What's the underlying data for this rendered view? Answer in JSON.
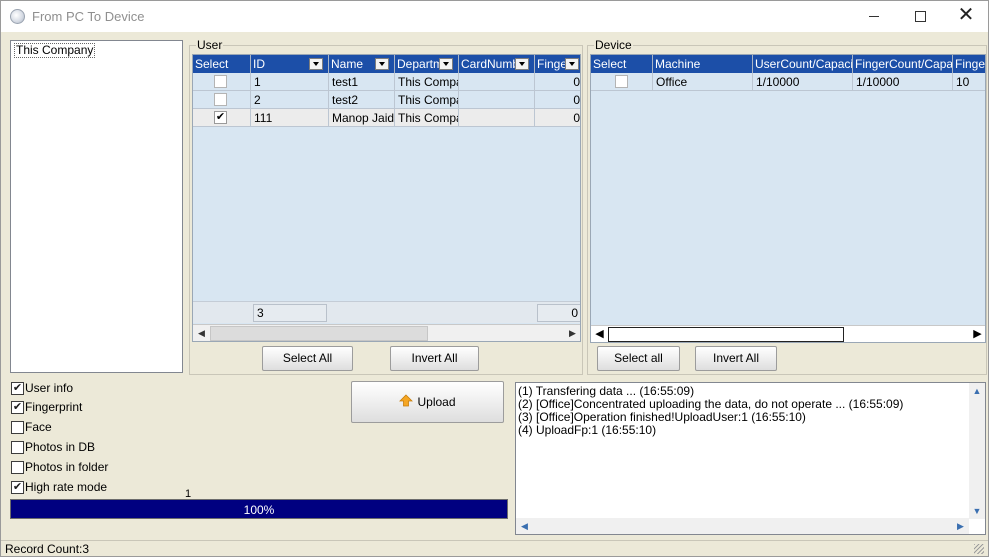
{
  "window": {
    "title": "From PC To Device"
  },
  "departments": [
    "This Company"
  ],
  "user_group": {
    "label": "User",
    "columns": [
      "Select",
      "ID",
      "Name",
      "Departm",
      "CardNumbe",
      "Finger"
    ],
    "rows": [
      {
        "selected": false,
        "id": "1",
        "name": "test1",
        "dept": "This Compai",
        "card": "",
        "finger": "0"
      },
      {
        "selected": false,
        "id": "2",
        "name": "test2",
        "dept": "This Compai",
        "card": "",
        "finger": "0"
      },
      {
        "selected": true,
        "id": "111",
        "name": "Manop Jaide",
        "dept": "This Compai",
        "card": "",
        "finger": "0"
      }
    ],
    "summary_id": "3",
    "summary_finger": "0",
    "select_all_label": "Select All",
    "invert_all_label": "Invert All"
  },
  "device_group": {
    "label": "Device",
    "columns": [
      "Select",
      "Machine",
      "UserCount/Capacity",
      "FingerCount/Capaci",
      "Finger"
    ],
    "rows": [
      {
        "selected": false,
        "machine": "Office",
        "users": "1/10000",
        "fingers": "1/10000",
        "finger": "10"
      }
    ],
    "select_all_label": "Select all",
    "invert_all_label": "Invert All"
  },
  "options": [
    {
      "label": "User info",
      "checked": true
    },
    {
      "label": "Fingerprint",
      "checked": true
    },
    {
      "label": "Face",
      "checked": false
    },
    {
      "label": "Photos in DB",
      "checked": false
    },
    {
      "label": "Photos in folder",
      "checked": false
    },
    {
      "label": "High rate mode",
      "checked": true
    }
  ],
  "upload": {
    "label": "Upload",
    "icon": "upload-arrow-icon",
    "icon_color": "#f5a623"
  },
  "progress": {
    "counter": "1",
    "text": "100%",
    "value": 1.0,
    "bar_color": "#000080"
  },
  "log": [
    "(1) Transfering data ... (16:55:09)",
    "(2) [Office]Concentrated uploading the data, do not operate ... (16:55:09)",
    "(3) [Office]Operation finished!UploadUser:1 (16:55:10)",
    "(4) UploadFp:1 (16:55:10)"
  ],
  "status": {
    "record_count": "Record Count:3"
  },
  "colors": {
    "grid_header": "#1c4fa8",
    "grid_body": "#d8e6f2",
    "window_bg": "#ece9d8"
  }
}
